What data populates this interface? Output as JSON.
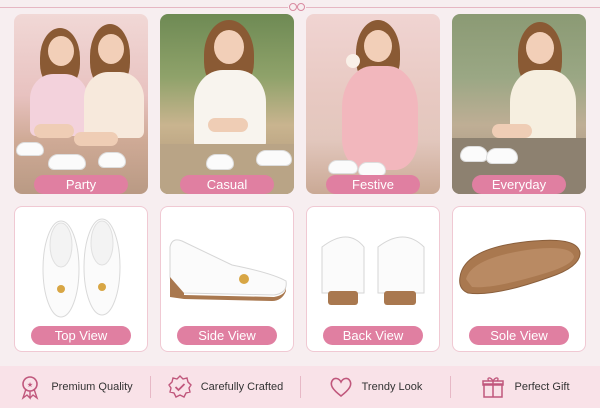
{
  "occasions": [
    {
      "label": "Party"
    },
    {
      "label": "Casual"
    },
    {
      "label": "Festive"
    },
    {
      "label": "Everyday"
    }
  ],
  "views": [
    {
      "label": "Top View"
    },
    {
      "label": "Side View"
    },
    {
      "label": "Back View"
    },
    {
      "label": "Sole View"
    }
  ],
  "features": [
    {
      "label": "Premium Quality",
      "icon": "award-ribbon-icon"
    },
    {
      "label": "Carefully Crafted",
      "icon": "check-badge-icon"
    },
    {
      "label": "Trendy Look",
      "icon": "heart-icon"
    },
    {
      "label": "Perfect Gift",
      "icon": "gift-box-icon"
    }
  ],
  "colors": {
    "accent_pink": "#e07fa1",
    "strip_bg": "#f9e2e8",
    "icon_stroke": "#c0577c",
    "shoe_white": "#fbfbfb",
    "sole_brown": "#a9784f"
  }
}
